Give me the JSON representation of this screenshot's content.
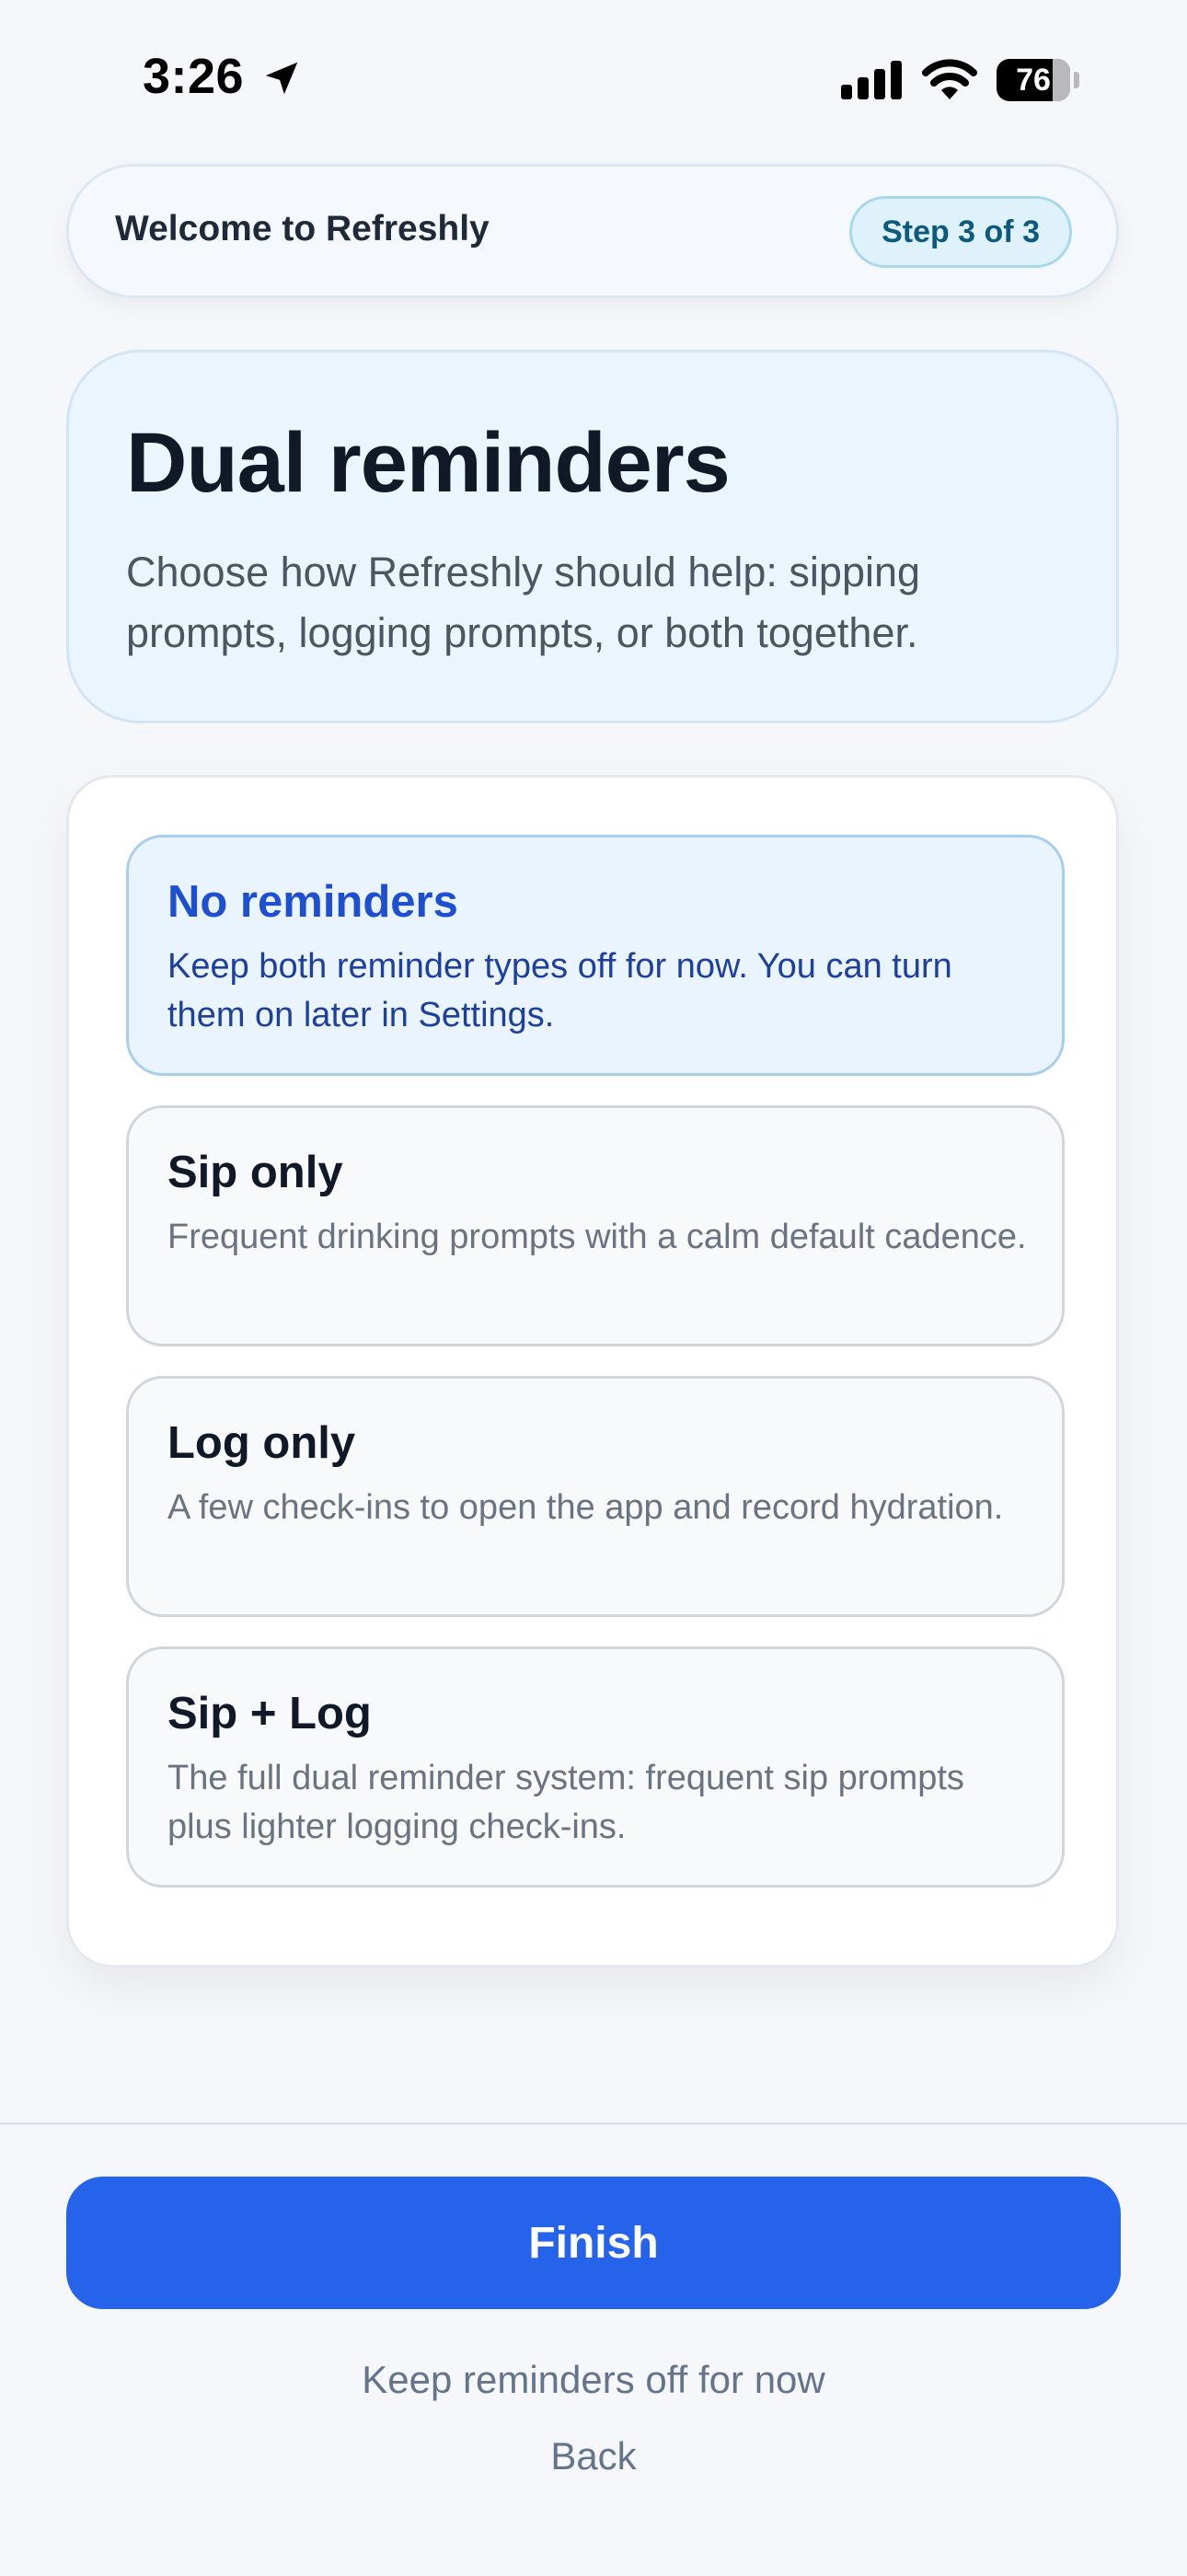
{
  "status_bar": {
    "time": "3:26",
    "battery_level": "76",
    "icons": [
      "location-arrow-icon",
      "signal-icon",
      "wifi-icon",
      "battery-icon"
    ]
  },
  "header": {
    "title": "Welcome to Refreshly",
    "step": "Step 3 of 3"
  },
  "hero": {
    "title": "Dual reminders",
    "description": "Choose how Refreshly should help: sipping prompts, logging prompts, or both together."
  },
  "options": [
    {
      "title": "No reminders",
      "description": "Keep both reminder types off for now. You can turn them on later in Settings.",
      "selected": true
    },
    {
      "title": "Sip only",
      "description": "Frequent drinking prompts with a calm default cadence.",
      "selected": false
    },
    {
      "title": "Log only",
      "description": "A few check-ins to open the app and record hydration.",
      "selected": false
    },
    {
      "title": "Sip + Log",
      "description": "The full dual reminder system: frequent sip prompts plus lighter logging check-ins.",
      "selected": false
    }
  ],
  "footer": {
    "primary_label": "Finish",
    "skip_label": "Keep reminders off for now",
    "back_label": "Back"
  },
  "colors": {
    "accent": "#2563eb",
    "selected_bg": "#eaf4fe",
    "selected_text": "#1f4fd1",
    "badge_bg": "#dff1fb",
    "hero_bg": "#ebf5ff"
  }
}
